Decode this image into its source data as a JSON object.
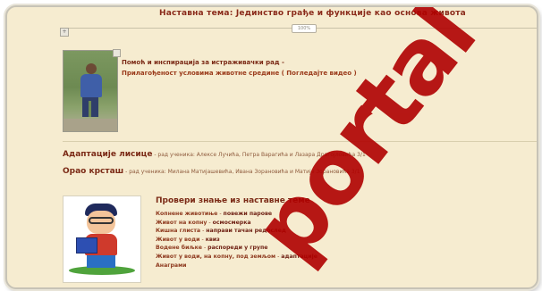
{
  "top_title": "Наставна тема: Јединство грађе и функције као основа живота",
  "hr_tag": "100%",
  "section1": {
    "line1": "Помоћ и инспирација за истраживачки рад -",
    "line2": "Прилагођеност услoвима животне средине ( Погледајте видео )"
  },
  "projects": [
    {
      "title": "Адаптације лисице",
      "sub": " - рад ученика: Алексе Лучића, Петра Варагића и Лазара Драгојловића 3/1"
    },
    {
      "title": "Орао крсташ",
      "sub": " - рад ученика: Милана Матијашевића, Ивана Зорановића и Матије Зорановића 3/1"
    }
  ],
  "section2": {
    "title": "Провери знање из наставне теме",
    "items": [
      {
        "topic": "Копнене животиње",
        "activity": "повежи парове"
      },
      {
        "topic": "Живот на копну",
        "activity": "осмосмерка"
      },
      {
        "topic": "Кишна глиста",
        "activity": "направи тачан редослед"
      },
      {
        "topic": "Живот у води",
        "activity": "квиз"
      },
      {
        "topic": "Водене биљке",
        "activity": "распореди у групе"
      },
      {
        "topic": "Живот у води, на копну, под земљом",
        "activity": "адаптације"
      },
      {
        "topic": "Анаграми",
        "activity": ""
      }
    ]
  },
  "watermark": "portal",
  "colors": {
    "card_bg": "#f6ecd0",
    "heading": "#7b2a16",
    "watermark": "#b00000"
  }
}
